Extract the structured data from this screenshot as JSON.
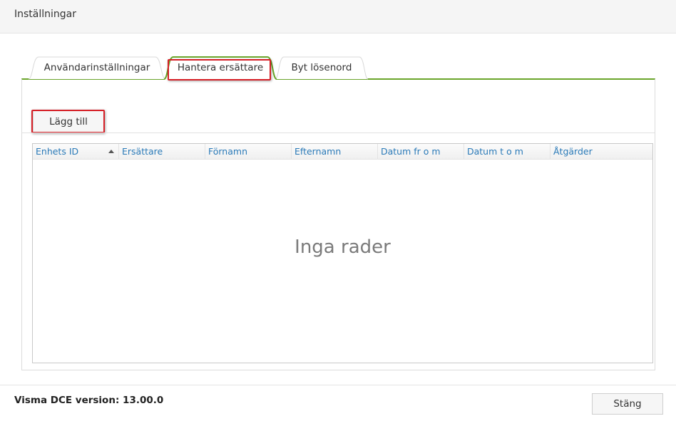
{
  "window": {
    "title": "Inställningar"
  },
  "tabs": [
    {
      "label": "Användarinställningar",
      "active": false
    },
    {
      "label": "Hantera ersättare",
      "active": true
    },
    {
      "label": "Byt lösenord",
      "active": false
    }
  ],
  "toolbar": {
    "add_label": "Lägg till"
  },
  "grid": {
    "columns": [
      {
        "label": "Enhets ID",
        "sorted": "asc"
      },
      {
        "label": "Ersättare"
      },
      {
        "label": "Förnamn"
      },
      {
        "label": "Efternamn"
      },
      {
        "label": "Datum fr o m"
      },
      {
        "label": "Datum t o m"
      },
      {
        "label": "Åtgärder"
      }
    ],
    "empty_text": "Inga rader"
  },
  "footer": {
    "version_text": "Visma DCE version: 13.00.0",
    "close_label": "Stäng"
  },
  "colors": {
    "accent_green": "#6aa52a",
    "highlight_red": "#d61f26",
    "header_link": "#2a7ab8"
  }
}
